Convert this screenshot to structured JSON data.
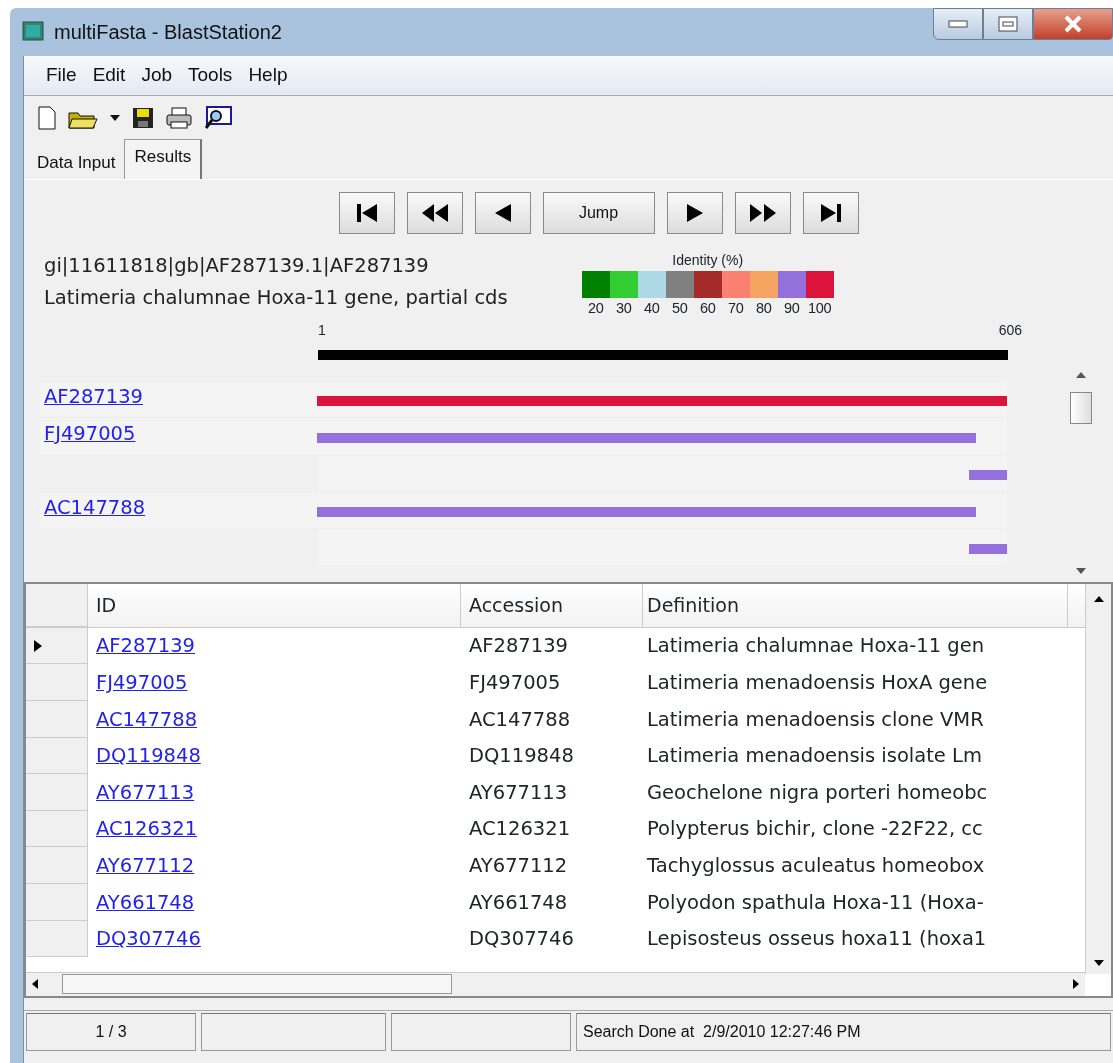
{
  "window": {
    "title": "multiFasta - BlastStation2"
  },
  "menu": [
    "File",
    "Edit",
    "Job",
    "Tools",
    "Help"
  ],
  "tabs": [
    {
      "label": "Data Input",
      "selected": false
    },
    {
      "label": "Results",
      "selected": true
    }
  ],
  "nav_buttons": [
    {
      "kind": "first"
    },
    {
      "kind": "rewind"
    },
    {
      "kind": "prev"
    },
    {
      "kind": "jump",
      "label": "Jump"
    },
    {
      "kind": "next"
    },
    {
      "kind": "forward"
    },
    {
      "kind": "last"
    }
  ],
  "query": {
    "id_line": "gi|11611818|gb|AF287139.1|AF287139",
    "description": "Latimeria chalumnae Hoxa-11 gene, partial cds"
  },
  "legend": {
    "title": "Identity (%)",
    "items": [
      {
        "label": "20",
        "color": "#008000"
      },
      {
        "label": "30",
        "color": "#33cc33"
      },
      {
        "label": "40",
        "color": "#add8e6"
      },
      {
        "label": "50",
        "color": "#808080"
      },
      {
        "label": "60",
        "color": "#a52a2a"
      },
      {
        "label": "70",
        "color": "#fa8072"
      },
      {
        "label": "80",
        "color": "#f4a460"
      },
      {
        "label": "90",
        "color": "#9370db"
      },
      {
        "label": "100",
        "color": "#dc143c"
      }
    ]
  },
  "ruler": {
    "start": "1",
    "end": "606"
  },
  "hits": [
    {
      "label": "AF287139",
      "segments": [
        {
          "kind": "left",
          "level": 1.0,
          "color": "#dc143c"
        }
      ]
    },
    {
      "label": "FJ497005",
      "segments": [
        {
          "kind": "left",
          "level": 0.955,
          "color": "#9370db"
        }
      ]
    },
    {
      "segments": [
        {
          "kind": "right",
          "level": 0.055,
          "color": "#9370db"
        }
      ]
    },
    {
      "label": "AC147788",
      "segments": [
        {
          "kind": "left",
          "level": 0.955,
          "color": "#9370db"
        }
      ]
    },
    {
      "segments": [
        {
          "kind": "right",
          "level": 0.055,
          "color": "#9370db"
        }
      ]
    }
  ],
  "table": {
    "columns": [
      "ID",
      "Accession",
      "Definition"
    ],
    "rows": [
      {
        "selected": true,
        "id": "AF287139",
        "accession": "AF287139",
        "definition": "Latimeria chalumnae Hoxa-11 gen"
      },
      {
        "selected": false,
        "id": "FJ497005",
        "accession": "FJ497005",
        "definition": "Latimeria menadoensis HoxA gene"
      },
      {
        "selected": false,
        "id": "AC147788",
        "accession": "AC147788",
        "definition": "Latimeria menadoensis clone VMR"
      },
      {
        "selected": false,
        "id": "DQ119848",
        "accession": "DQ119848",
        "definition": "Latimeria menadoensis isolate Lm"
      },
      {
        "selected": false,
        "id": "AY677113",
        "accession": "AY677113",
        "definition": "Geochelone nigra porteri homeobc"
      },
      {
        "selected": false,
        "id": "AC126321",
        "accession": "AC126321",
        "definition": "Polypterus bichir, clone -22F22, cc"
      },
      {
        "selected": false,
        "id": "AY677112",
        "accession": "AY677112",
        "definition": "Tachyglossus aculeatus homeobox"
      },
      {
        "selected": false,
        "id": "AY661748",
        "accession": "AY661748",
        "definition": "Polyodon spathula Hoxa-11 (Hoxa-"
      },
      {
        "selected": false,
        "id": "DQ307746",
        "accession": "DQ307746",
        "definition": "Lepisosteus osseus hoxa11 (hoxa1"
      }
    ]
  },
  "status_bar": {
    "page": "1 / 3",
    "message": "Search Done at  2/9/2010 12:27:46 PM"
  }
}
